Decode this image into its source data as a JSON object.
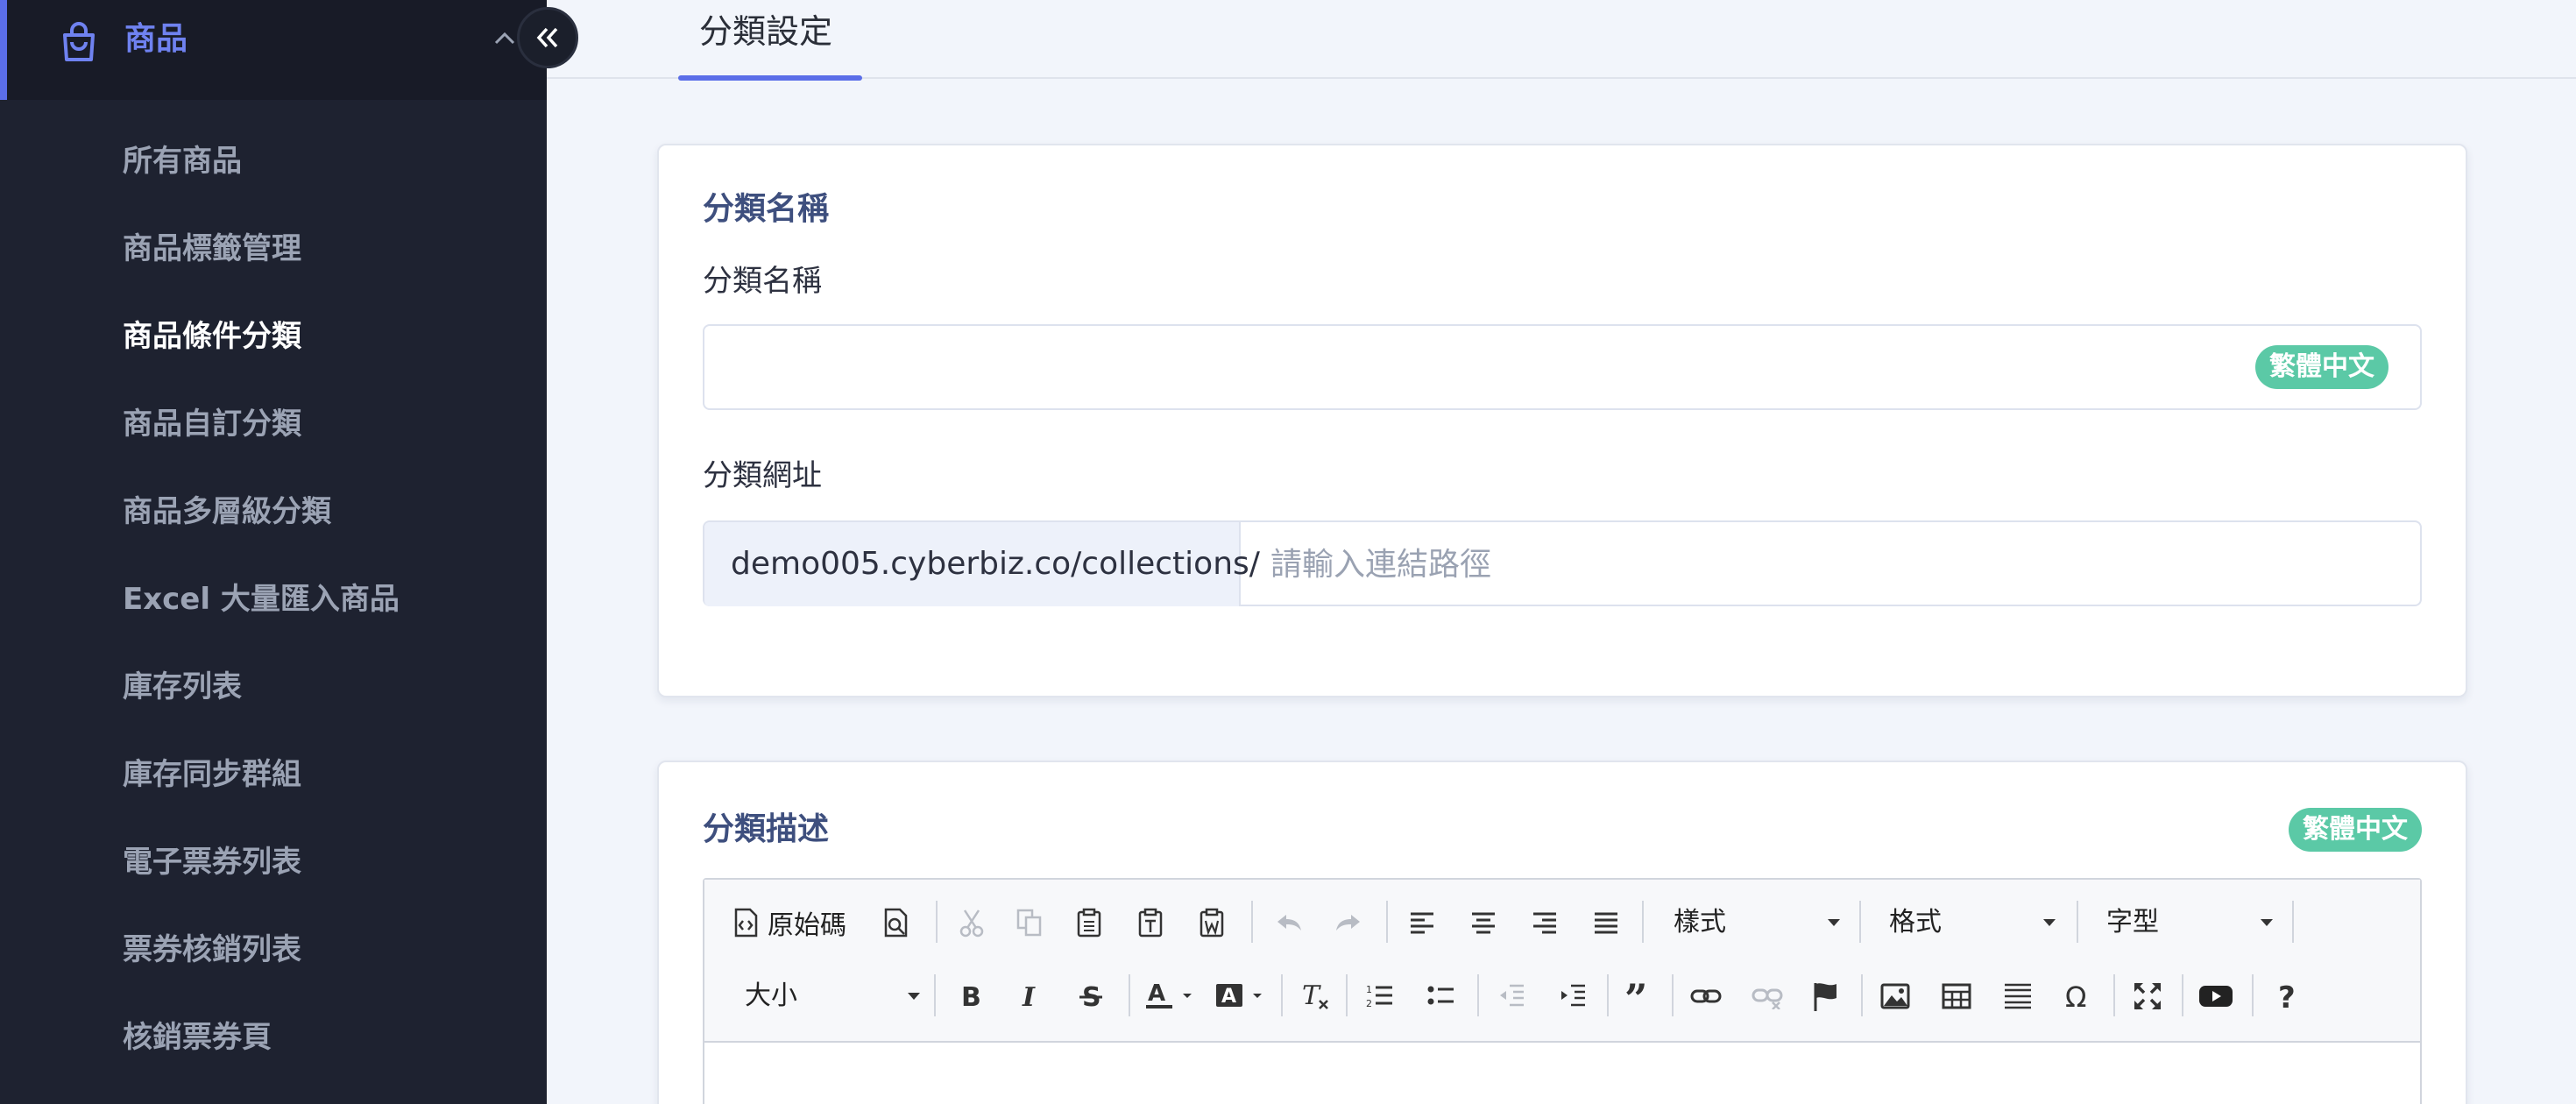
{
  "sidebar": {
    "section_title": "商品",
    "items": [
      {
        "label": "所有商品"
      },
      {
        "label": "商品標籤管理"
      },
      {
        "label": "商品條件分類",
        "current": true
      },
      {
        "label": "商品自訂分類"
      },
      {
        "label": "商品多層級分類"
      },
      {
        "label": "Excel 大量匯入商品"
      },
      {
        "label": "庫存列表"
      },
      {
        "label": "庫存同步群組"
      },
      {
        "label": "電子票券列表"
      },
      {
        "label": "票券核銷列表"
      },
      {
        "label": "核銷票券頁"
      }
    ]
  },
  "tabs": {
    "active": "分類設定"
  },
  "name_card": {
    "title": "分類名稱",
    "name_label": "分類名稱",
    "name_value": "",
    "lang_badge": "繁體中文",
    "url_label": "分類網址",
    "url_prefix": "demo005.cyberbiz.co/collections/",
    "url_placeholder": "請輸入連結路徑",
    "url_value": ""
  },
  "desc_card": {
    "title": "分類描述",
    "lang_badge": "繁體中文",
    "toolbar": {
      "source_label": "原始碼",
      "style_combo": "樣式",
      "format_combo": "格式",
      "font_combo": "字型",
      "size_combo": "大小"
    }
  },
  "colors": {
    "sidebar_bg": "#1e2230",
    "accent": "#5b6ee8",
    "badge": "#5bc9a6",
    "card_title": "#3e4f7e"
  }
}
